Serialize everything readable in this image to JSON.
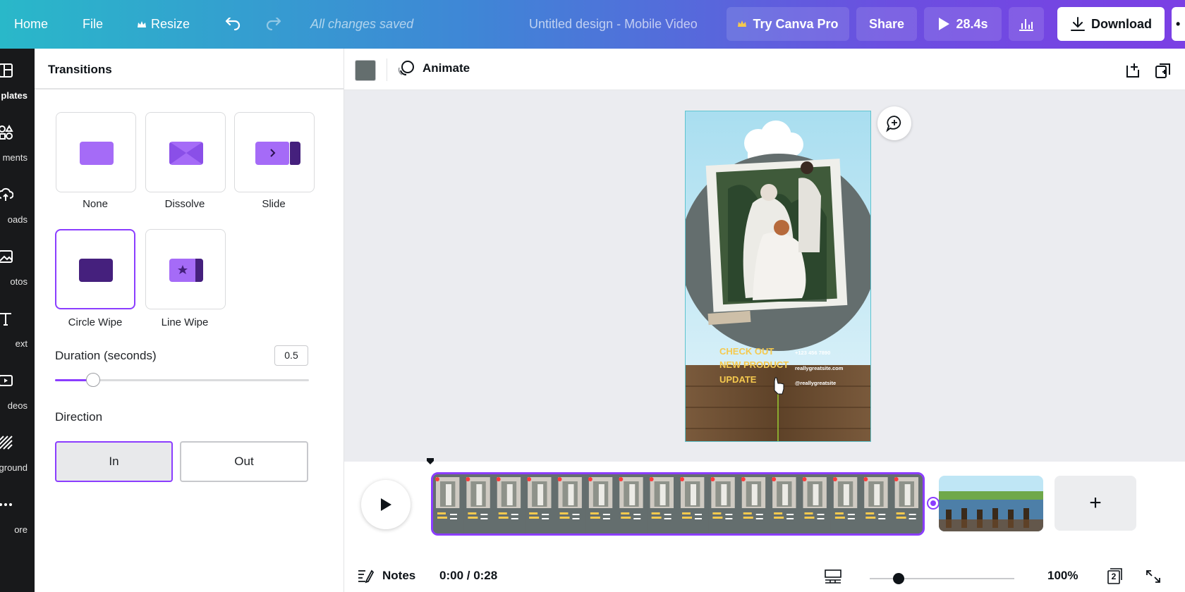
{
  "topbar": {
    "home": "Home",
    "file": "File",
    "resize": "Resize",
    "saved_status": "All changes saved",
    "doc_title": "Untitled design - Mobile Video",
    "try_pro": "Try Canva Pro",
    "share": "Share",
    "play_duration": "28.4s",
    "download": "Download",
    "more": "•"
  },
  "rail": {
    "items": [
      {
        "label": "plates",
        "icon": "templates-icon"
      },
      {
        "label": "ments",
        "icon": "elements-icon"
      },
      {
        "label": "oads",
        "icon": "uploads-icon"
      },
      {
        "label": "otos",
        "icon": "photos-icon"
      },
      {
        "label": "ext",
        "icon": "text-icon"
      },
      {
        "label": "deos",
        "icon": "videos-icon"
      },
      {
        "label": "ground",
        "icon": "background-icon"
      },
      {
        "label": "ore",
        "icon": "more-icon"
      }
    ]
  },
  "panel": {
    "title": "Transitions",
    "transitions": [
      {
        "label": "None",
        "color": "#a56bf7"
      },
      {
        "label": "Dissolve",
        "color": "#a56bf7"
      },
      {
        "label": "Slide",
        "color": "#a56bf7"
      },
      {
        "label": "Circle Wipe",
        "color": "#45207d"
      },
      {
        "label": "Line Wipe",
        "color": "#a56bf7"
      }
    ],
    "selected_transition": "Circle Wipe",
    "duration_label": "Duration (seconds)",
    "duration_value": "0.5",
    "duration_fraction": 0.15,
    "direction_label": "Direction",
    "direction_in": "In",
    "direction_out": "Out",
    "direction_selected": "In"
  },
  "toolbar": {
    "color_swatch": "#646e6e",
    "animate": "Animate"
  },
  "design": {
    "headline_lines": [
      "CHECK OUT",
      "NEW PRODUCT",
      "UPDATE"
    ],
    "contact": [
      "+123 456 7890",
      "reallygreatsite.com",
      "@reallygreatsite"
    ],
    "accent": "#f5c94e",
    "bg": "#646e6e"
  },
  "timeline": {
    "accent": "#8b3dff",
    "add_page": "+"
  },
  "footer": {
    "notes": "Notes",
    "time": "0:00 / 0:28",
    "zoom": "100%",
    "zoom_fraction": 0.2,
    "page_count": "2"
  }
}
